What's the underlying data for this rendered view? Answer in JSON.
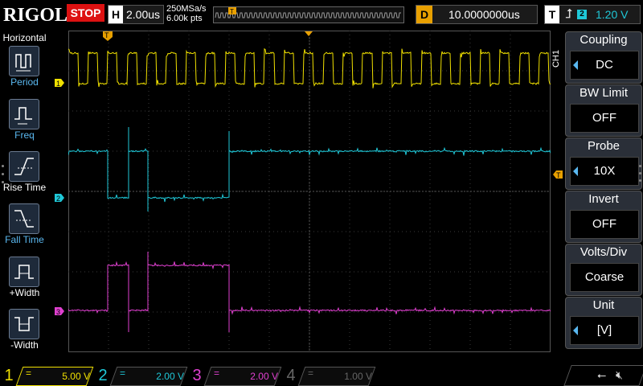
{
  "topbar": {
    "logo": "RIGOL",
    "run_state": "STOP",
    "horizontal_key": "H",
    "timebase": "2.00us",
    "sample_rate": "250MSa/s",
    "memory_depth": "6.00k pts",
    "delay_key": "D",
    "delay_value": "10.0000000us",
    "trigger_key": "T",
    "trigger_source": "2",
    "trigger_level": "1.20 V",
    "trigger_pos_marker": "T"
  },
  "left_menu": {
    "title": "Horizontal",
    "items": [
      {
        "label": "Period",
        "icon": "period-measure-icon"
      },
      {
        "label": "Freq",
        "icon": "freq-measure-icon"
      },
      {
        "label": "Rise Time",
        "icon": "rise-time-icon"
      },
      {
        "label": "Fall Time",
        "icon": "fall-time-icon"
      },
      {
        "label": "+Width",
        "icon": "pos-width-icon"
      },
      {
        "label": "-Width",
        "icon": "neg-width-icon"
      }
    ]
  },
  "channel_markers": [
    "1",
    "2",
    "3"
  ],
  "trigger_level_marker": "T",
  "right_menu": {
    "channel_label": "CH1",
    "items": [
      {
        "title": "Coupling",
        "value": "DC",
        "arrow": true
      },
      {
        "title": "BW Limit",
        "value": "OFF",
        "arrow": false
      },
      {
        "title": "Probe",
        "value": "10X",
        "arrow": true
      },
      {
        "title": "Invert",
        "value": "OFF",
        "arrow": false
      },
      {
        "title": "Volts/Div",
        "value": "Coarse",
        "arrow": false
      },
      {
        "title": "Unit",
        "value": "[V]",
        "arrow": true
      }
    ]
  },
  "bottom": {
    "channels": [
      {
        "num": "1",
        "scale": "5.00 V",
        "coupling": "=",
        "color": "#f0e000"
      },
      {
        "num": "2",
        "scale": "2.00 V",
        "coupling": "=",
        "color": "#1fc8d8"
      },
      {
        "num": "3",
        "scale": "2.00 V",
        "coupling": "=",
        "color": "#e040d0"
      },
      {
        "num": "4",
        "scale": "1.00 V",
        "coupling": "=",
        "color": "#3a5ad8"
      }
    ]
  },
  "colors": {
    "ch1": "#f0e000",
    "ch2": "#1fc8d8",
    "ch3": "#e040d0",
    "ch4": "#3a5ad8",
    "stop": "#dd1111",
    "delay": "#e8a000",
    "grid": "#444444"
  },
  "icons": {
    "trigger_edge": "rising-edge-icon",
    "usb": "usb-icon",
    "sound": "speaker-muted-icon"
  }
}
